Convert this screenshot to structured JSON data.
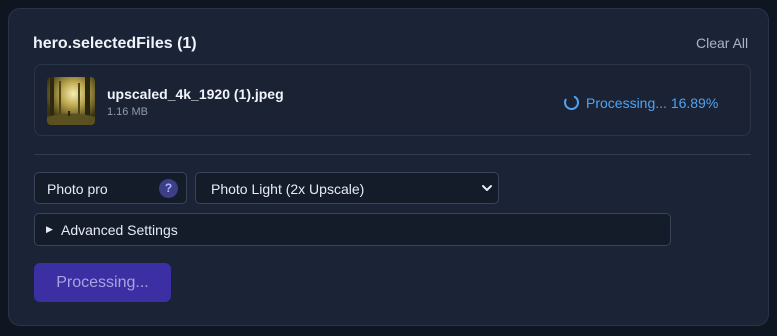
{
  "panel": {
    "title": "hero.selectedFiles (1)",
    "clear_all_label": "Clear All"
  },
  "file": {
    "name": "upscaled_4k_1920 (1).jpeg",
    "size": "1.16 MB",
    "status": "Processing... 16.89%",
    "progress_percent": 16.89,
    "status_color": "#4fa3f5",
    "thumbnail_icon": "forest-sunlight-image"
  },
  "model": {
    "label": "Photo pro",
    "help_label": "?"
  },
  "preset": {
    "selected": "Photo Light (2x Upscale)"
  },
  "advanced": {
    "label": "Advanced Settings",
    "arrow": "▶"
  },
  "action": {
    "button_label": "Processing...",
    "accent": "#3b2fa3"
  }
}
